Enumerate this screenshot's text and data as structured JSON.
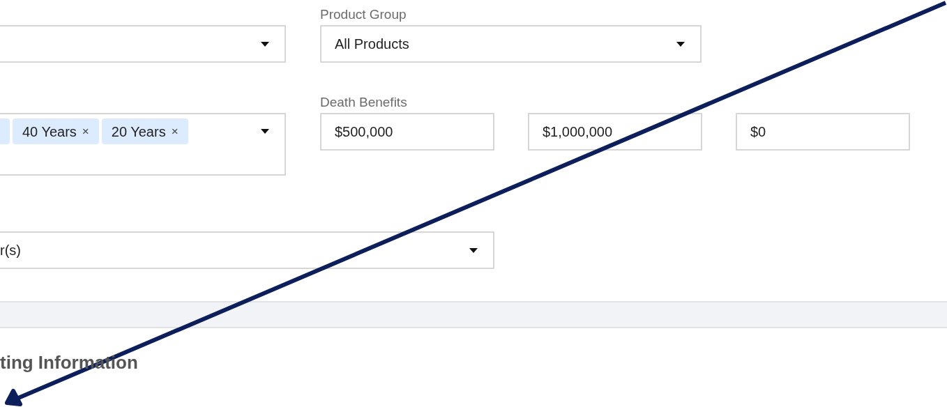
{
  "product_group": {
    "label": "Product Group",
    "value": "All Products"
  },
  "term_select": {
    "tags": [
      {
        "label": "40 Years",
        "remove": "×"
      },
      {
        "label": "20 Years",
        "remove": "×"
      }
    ]
  },
  "death_benefits": {
    "label": "Death Benefits",
    "values": [
      "$500,000",
      "$1,000,000",
      "$0"
    ]
  },
  "third_select": {
    "value": "r(s)"
  },
  "section_heading": "ting Information"
}
